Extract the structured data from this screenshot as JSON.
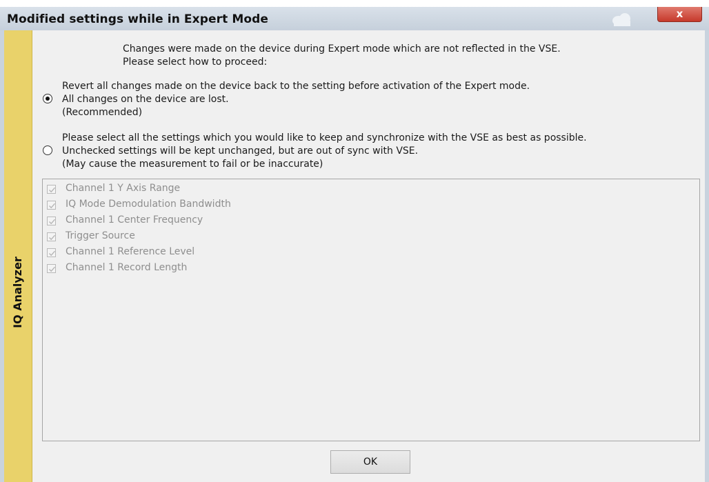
{
  "window": {
    "title": "Modified settings while in Expert Mode",
    "close_label": "x",
    "side_tab_label": "IQ Analyzer"
  },
  "intro": {
    "line1": "Changes were made on the device during Expert mode which are not reflected in the VSE.",
    "line2": "Please select how to proceed:"
  },
  "options": [
    {
      "selected": true,
      "line1": "Revert all changes made on the device back to the setting before activation of the Expert mode.",
      "line2": "All changes on the device are lost.",
      "line3": "(Recommended)"
    },
    {
      "selected": false,
      "line1": "Please select all the settings which you would like to keep and synchronize with the VSE as best as possible.",
      "line2": "Unchecked settings will be kept unchanged, but are out of sync with VSE.",
      "line3": "(May cause the measurement to fail or be inaccurate)"
    }
  ],
  "settings": [
    {
      "label": "Channel 1 Y Axis Range",
      "checked": true,
      "enabled": false
    },
    {
      "label": "IQ Mode Demodulation Bandwidth",
      "checked": true,
      "enabled": false
    },
    {
      "label": "Channel 1 Center Frequency",
      "checked": true,
      "enabled": false
    },
    {
      "label": "Trigger Source",
      "checked": true,
      "enabled": false
    },
    {
      "label": "Channel 1 Reference Level",
      "checked": true,
      "enabled": false
    },
    {
      "label": "Channel 1 Record Length",
      "checked": true,
      "enabled": false
    }
  ],
  "buttons": {
    "ok_label": "OK"
  },
  "colors": {
    "side_tab": "#e9d26a",
    "close_button": "#c6392b",
    "disabled_text": "#8e8e8e"
  }
}
